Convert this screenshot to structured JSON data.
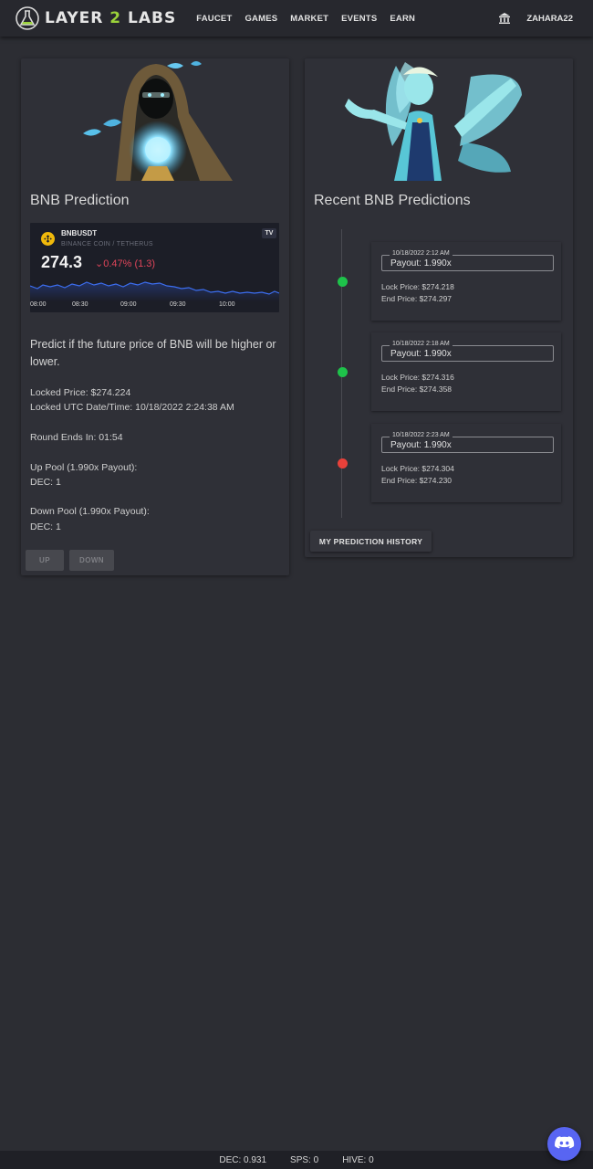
{
  "header": {
    "brand_prefix": "LAYER ",
    "brand_accent": "2",
    "brand_suffix": " LABS",
    "nav": [
      "FAUCET",
      "GAMES",
      "MARKET",
      "EVENTS",
      "EARN"
    ],
    "username": "ZAHARA22"
  },
  "prediction": {
    "title": "BNB Prediction",
    "ticker": {
      "symbol": "BNBUSDT",
      "subtitle": "BINANCE COIN / TETHERUS",
      "price": "274.3",
      "change": "⌄0.47% (1.3)",
      "badge": "TV",
      "times": [
        "08:00",
        "08:30",
        "09:00",
        "09:30",
        "10:00"
      ]
    },
    "prompt": "Predict if the future price of BNB will be higher or lower.",
    "locked_price": "Locked Price: $274.224",
    "locked_time": "Locked UTC Date/Time: 10/18/2022 2:24:38 AM",
    "round_ends": "Round Ends In: 01:54",
    "up_pool_label": "Up Pool (1.990x Payout):",
    "up_pool_value": "DEC: 1",
    "down_pool_label": "Down Pool (1.990x Payout):",
    "down_pool_value": "DEC: 1",
    "up_button": "UP",
    "down_button": "DOWN"
  },
  "recent": {
    "title": "Recent BNB Predictions",
    "items": [
      {
        "date": "10/18/2022 2:12 AM",
        "payout": "Payout: 1.990x",
        "lock": "Lock Price: $274.218",
        "end": "End Price: $274.297",
        "result_color": "#1ec24a"
      },
      {
        "date": "10/18/2022 2:18 AM",
        "payout": "Payout: 1.990x",
        "lock": "Lock Price: $274.316",
        "end": "End Price: $274.358",
        "result_color": "#1ec24a"
      },
      {
        "date": "10/18/2022 2:23 AM",
        "payout": "Payout: 1.990x",
        "lock": "Lock Price: $274.304",
        "end": "End Price: $274.230",
        "result_color": "#e8413a"
      }
    ],
    "history_button": "MY PREDICTION HISTORY"
  },
  "footer": {
    "dec": "DEC: 0.931",
    "sps": "SPS: 0",
    "hive": "HIVE: 0"
  },
  "colors": {
    "accent_green": "#9bd23a",
    "down_red": "#e0455a",
    "discord": "#5865f2"
  }
}
